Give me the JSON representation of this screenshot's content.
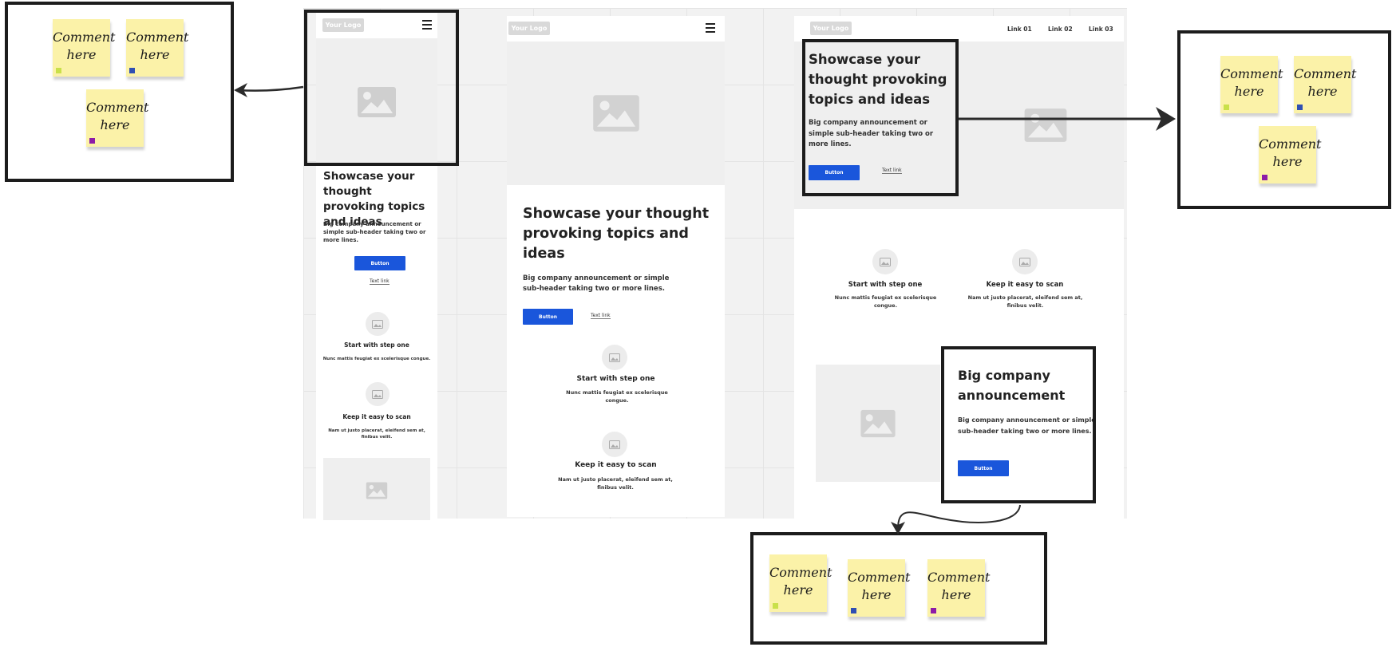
{
  "notes": {
    "comment_text": "Comment\nhere",
    "tag_colors": {
      "green": "#c9e04a",
      "blue": "#2f4fb3",
      "purple": "#8d1ca8"
    }
  },
  "mockup": {
    "logo": "Your Logo",
    "nav_links": [
      "Link 01",
      "Link 02",
      "Link 03"
    ],
    "hero_title": "Showcase your thought provoking topics and ideas",
    "hero_subtitle_mobile": "Big company announcement or simple sub-header taking two or more lines.",
    "hero_subtitle_tablet": "Big company announcement or simple sub-header taking two or more lines.",
    "hero_subtitle_desktop": "Big company announcement or simple sub-header taking two or more lines.",
    "button_label": "Button",
    "text_link": "Text link",
    "features": [
      {
        "title": "Start with step one",
        "desc": "Nunc mattis feugiat ex scelerisque congue."
      },
      {
        "title": "Keep it easy to scan",
        "desc": "Nam ut justo placerat, eleifend sem at, finibus velit."
      }
    ],
    "announcement_title": "Big company announcement",
    "announcement_subtitle": "Big company announcement or simple sub-header taking two or more lines."
  },
  "colors": {
    "button": "#1a56db",
    "sticky": "#fbf2a8",
    "border": "#1c1c1c"
  }
}
